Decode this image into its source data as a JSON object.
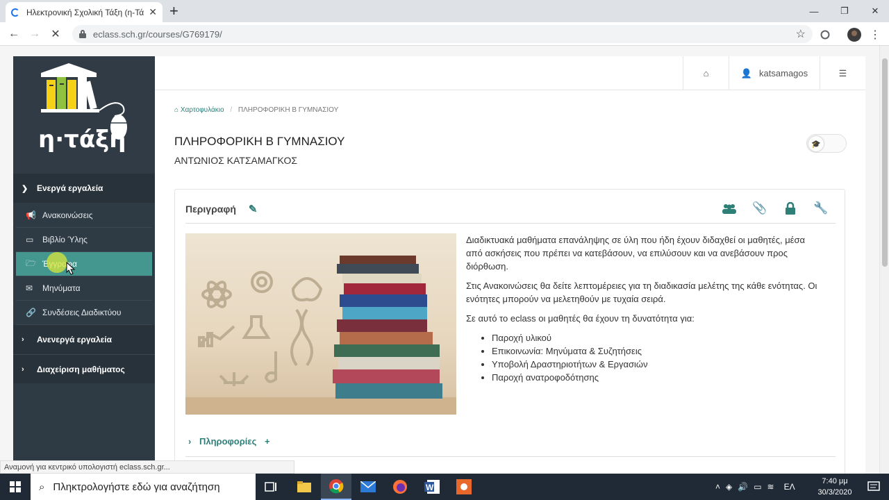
{
  "browser": {
    "tab_title": "Ηλεκτρονική Σχολική Τάξη (η-Τά",
    "url": "eclass.sch.gr/courses/G769179/"
  },
  "sidebar": {
    "logo_text": "η·τάξη",
    "active_tools_label": "Ενεργά εργαλεία",
    "items": [
      {
        "label": "Ανακοινώσεις",
        "icon": "megaphone-icon"
      },
      {
        "label": "Βιβλίο Ύλης",
        "icon": "calendar-icon"
      },
      {
        "label": "Έγγραφα",
        "icon": "folder-open-icon"
      },
      {
        "label": "Μηνύματα",
        "icon": "envelope-icon"
      },
      {
        "label": "Συνδέσεις Διαδικτύου",
        "icon": "link-icon"
      }
    ],
    "inactive_tools_label": "Ανενεργά εργαλεία",
    "course_admin_label": "Διαχείριση μαθήματος"
  },
  "topbar": {
    "username": "katsamagos"
  },
  "breadcrumb": {
    "home": "Χαρτοφυλάκιο",
    "current": "ΠΛΗΡΟΦΟΡΙΚΗ Β ΓΥΜΝΑΣΙΟΥ"
  },
  "course": {
    "title": "ΠΛΗΡΟΦΟΡΙΚΗ Β ΓΥΜΝΑΣΙΟΥ",
    "teacher": "ΑΝΤΩΝΙΟΣ ΚΑΤΣΑΜΑΓΚΟΣ"
  },
  "panel": {
    "title": "Περιγραφή",
    "para1": "Διαδικτυακά μαθήματα επανάληψης σε ύλη που ήδη έχουν διδαχθεί οι μαθητές, μέσα από ασκήσεις που πρέπει να κατεβάσουν, να επιλύσουν και να ανεβάσουν προς διόρθωση.",
    "para2": "Στις Ανακοινώσεις θα δείτε λεπτομέρειες για τη διαδικασία μελέτης της κάθε ενότητας. Οι ενότητες μπορούν να μελετηθούν με τυχαία σειρά.",
    "para3": "Σε αυτό το eclass οι μαθητές θα έχουν τη δυνατότητα για:",
    "list": [
      "Παροχή υλικού",
      "Επικοινωνία: Μηνύματα & Συζητήσεις",
      "Υποβολή Δραστηριοτήτων & Εργασιών",
      "Παροχή ανατροφοδότησης"
    ],
    "info_label": "Πληροφορίες"
  },
  "statusbar": "Αναμονή για κεντρικό υπολογιστή eclass.sch.gr...",
  "taskbar": {
    "search_placeholder": "Πληκτρολογήστε εδώ για αναζήτηση",
    "lang": "ΕΛ",
    "time": "7:40 μμ",
    "date": "30/3/2020"
  },
  "colors": {
    "accent": "#43978e",
    "sidebar": "#2e3a44"
  }
}
